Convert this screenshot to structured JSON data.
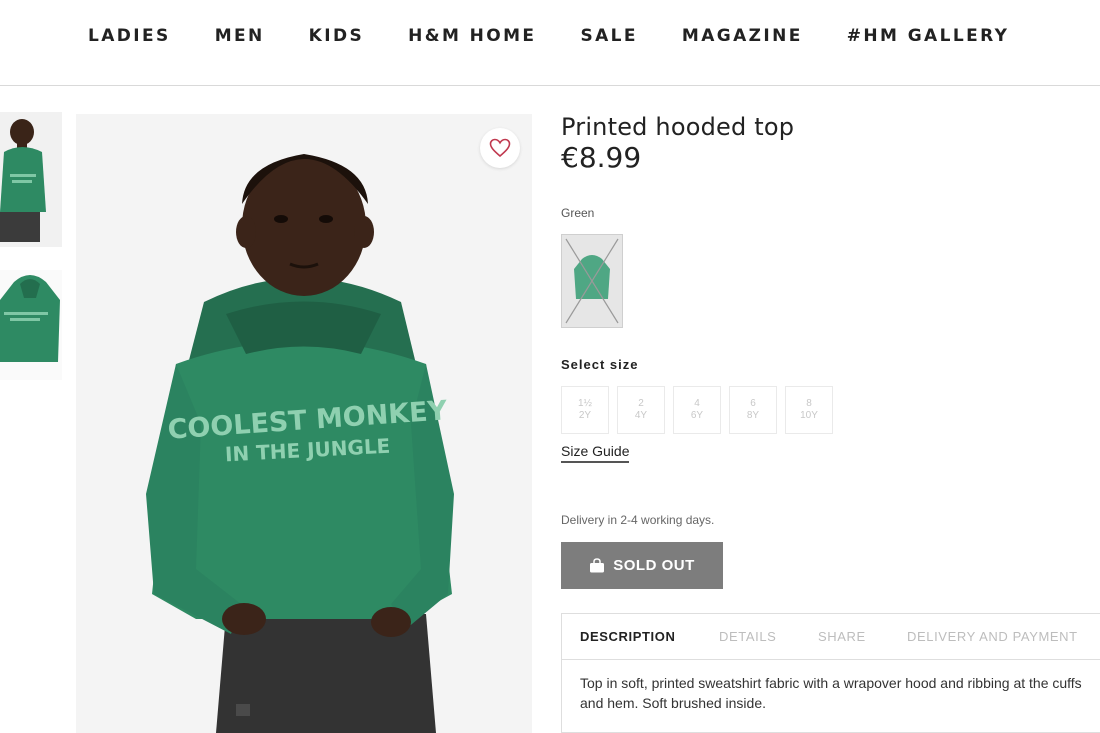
{
  "nav": {
    "items": [
      "LADIES",
      "MEN",
      "KIDS",
      "H&M HOME",
      "SALE",
      "MAGAZINE",
      "#HM GALLERY"
    ]
  },
  "product": {
    "title": "Printed hooded top",
    "price": "€8.99",
    "color_name": "Green",
    "hoodie_print_line1": "COOLEST MONKEY",
    "hoodie_print_line2": "IN THE JUNGLE",
    "hoodie_color": "#2e8a63",
    "sold_out_color": "#7d7d7d"
  },
  "sizes": {
    "label": "Select size",
    "options": [
      {
        "top": "1½",
        "bottom": "2Y"
      },
      {
        "top": "2",
        "bottom": "4Y"
      },
      {
        "top": "4",
        "bottom": "6Y"
      },
      {
        "top": "6",
        "bottom": "8Y"
      },
      {
        "top": "8",
        "bottom": "10Y"
      }
    ],
    "guide_label": "Size Guide"
  },
  "purchase": {
    "delivery_text": "Delivery in 2-4 working days.",
    "button_label": "SOLD OUT",
    "button_icon": "shopping-bag-icon"
  },
  "details": {
    "tabs": [
      "DESCRIPTION",
      "DETAILS",
      "SHARE",
      "DELIVERY AND PAYMENT"
    ],
    "active_tab": "DESCRIPTION",
    "description": "Top in soft, printed sweatshirt fabric with a wrapover hood and ribbing at the cuffs and hem. Soft brushed inside."
  }
}
